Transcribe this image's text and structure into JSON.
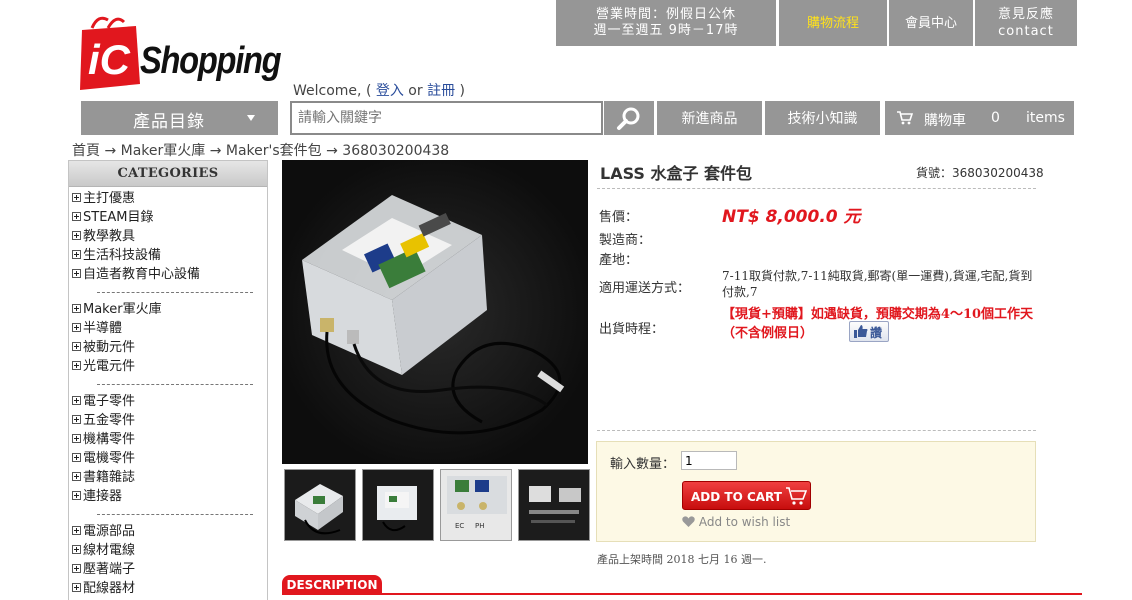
{
  "header": {
    "logo_text": "Shopping",
    "logo_badge": "iC",
    "hours_line1": "營業時間：例假日公休",
    "hours_line2": "週一至週五 9時－17時",
    "nav_flow": "購物流程",
    "nav_member": "會員中心",
    "nav_contact_line1": "意見反應",
    "nav_contact_line2": "contact"
  },
  "welcome": {
    "prefix": "Welcome, ( ",
    "login": "登入",
    "or": " or ",
    "register": "註冊",
    "suffix": " )"
  },
  "searchbar": {
    "category_label": "產品目錄",
    "search_placeholder": "請輸入關鍵字",
    "new_products": "新進商品",
    "tips": "技術小知識",
    "cart_label": "購物車",
    "cart_count": "0",
    "cart_items": "items"
  },
  "breadcrumb": "首頁 → Maker軍火庫 → Maker's套件包 → 368030200438",
  "sidebar": {
    "title": "CATEGORIES",
    "items": [
      "主打優惠",
      "STEAM目錄",
      "教學教具",
      "生活科技設備",
      "自造者教育中心設備",
      "Maker軍火庫",
      "半導體",
      "被動元件",
      "光電元件",
      "電子零件",
      "五金零件",
      "機構零件",
      "電機零件",
      "書籍雜誌",
      "連接器",
      "電源部品",
      "線材電線",
      "壓著端子",
      "配線器材"
    ]
  },
  "product": {
    "title": "LASS 水盒子 套件包",
    "sku_label": "貨號：",
    "sku": "368030200438",
    "price_label": "售價：",
    "price": "NT$ 8,000.0 元",
    "maker_label": "製造商：",
    "origin_label": "產地：",
    "shipping_label": "適用運送方式：",
    "shipping_value": "7-11取貨付款,7-11純取貨,郵寄(單一運費),貨運,宅配,貨到付款,7",
    "dispatch_label": "出貨時程：",
    "dispatch_value": "【現貨+預購】如遇缺貨，預購交期為4～10個工作天（不含例假日）",
    "like_label": "讚",
    "qty_label": "輸入數量：",
    "qty_value": "1",
    "add_to_cart": "ADD TO CART",
    "wishlist": "Add to wish list",
    "listed_date": "產品上架時間 2018 七月 16 週一."
  },
  "thumb_labels": [
    "EC",
    "PH"
  ],
  "tabs": {
    "description": "DESCRIPTION"
  },
  "colors": {
    "accent_red": "#e1171e",
    "nav_gray": "#969696",
    "flow_yellow": "#ffe21a"
  }
}
